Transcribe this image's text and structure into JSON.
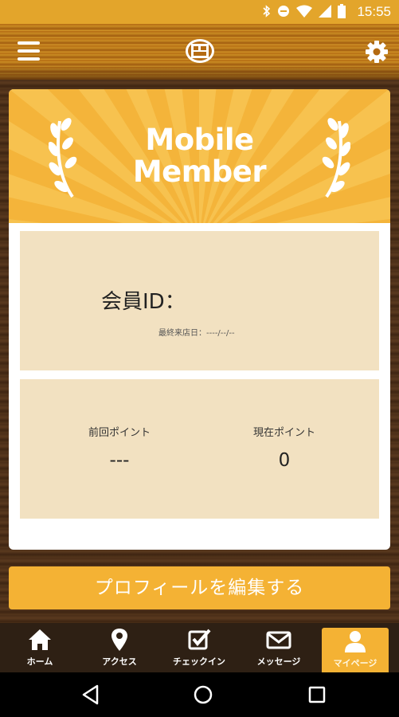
{
  "status_bar": {
    "time": "15:55",
    "icons": [
      "bluetooth-icon",
      "do-not-disturb-icon",
      "wifi-icon",
      "cell-signal-icon",
      "battery-icon"
    ]
  },
  "app_bar": {
    "menu_icon": "hamburger-menu-icon",
    "logo_icon": "shop-logo-icon",
    "settings_icon": "gear-icon"
  },
  "banner": {
    "title_line1": "Mobile",
    "title_line2": "Member",
    "background_color": "#f4b43a"
  },
  "member": {
    "id_label": "会員ID：",
    "last_visit_label": "最終来店日：",
    "last_visit_value": "----/--/--"
  },
  "points": {
    "previous_label": "前回ポイント",
    "previous_value": "---",
    "current_label": "現在ポイント",
    "current_value": "0"
  },
  "edit_profile_button": "プロフィールを編集する",
  "tabs": [
    {
      "label": "ホーム",
      "icon": "home-icon"
    },
    {
      "label": "アクセス",
      "icon": "map-pin-icon"
    },
    {
      "label": "チェックイン",
      "icon": "checkbox-icon"
    },
    {
      "label": "メッセージ",
      "icon": "mail-icon"
    },
    {
      "label": "マイページ",
      "icon": "person-icon",
      "active": true
    }
  ],
  "accent_color": "#f4b234"
}
